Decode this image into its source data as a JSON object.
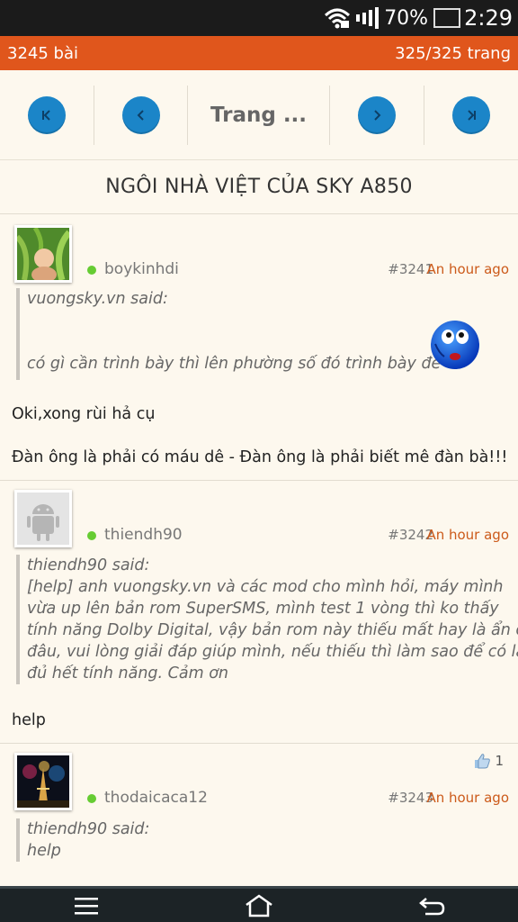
{
  "status_bar": {
    "battery_percent": "70%",
    "time": "2:29"
  },
  "topbar": {
    "post_count": "3245 bài",
    "page_count": "325/325 trang"
  },
  "pager": {
    "label": "Trang ..."
  },
  "thread": {
    "title": "NGÔI NHÀ VIỆT CỦA SKY A850"
  },
  "posts": [
    {
      "username": "boykinhdi",
      "number": "#3241",
      "time": "An hour ago",
      "quote_author": "vuongsky.vn said:",
      "quote_lines": [
        "có gì cần trình bày thì lên phường số đó trình bày đê"
      ],
      "body_lines": [
        "Oki,xong rùi hả cụ",
        "Đàn ông là phải có máu dê - Đàn ông là phải biết mê đàn bà!!!"
      ]
    },
    {
      "username": "thiendh90",
      "number": "#3242",
      "time": "An hour ago",
      "quote_author": "thiendh90 said:",
      "quote_lines": [
        "[help] anh vuongsky.vn và các mod cho mình hỏi, máy mình",
        "vừa up lên bản rom SuperSMS, mình test 1 vòng thì ko thấy",
        "tính năng Dolby Digital, vậy bản rom này thiếu mất hay là ẩn ở",
        "đâu, vui lòng giải đáp giúp mình, nếu thiếu thì làm sao để có lại",
        "đủ hết tính năng. Cảm ơn"
      ],
      "body_lines": [
        "help"
      ]
    },
    {
      "username": "thodaicaca12",
      "number": "#3243",
      "time": "An hour ago",
      "likes": "1",
      "quote_author": "thiendh90 said:",
      "quote_lines": [
        "help"
      ]
    }
  ],
  "icons": {
    "first": "first-page-icon",
    "prev": "prev-page-icon",
    "next": "next-page-icon",
    "last": "last-page-icon",
    "menu": "menu-icon",
    "home": "home-icon",
    "back": "back-icon"
  },
  "colors": {
    "accent": "#e0561c",
    "pager_button": "#1b85c8",
    "time": "#cc5a1a",
    "online": "#66cc33"
  }
}
